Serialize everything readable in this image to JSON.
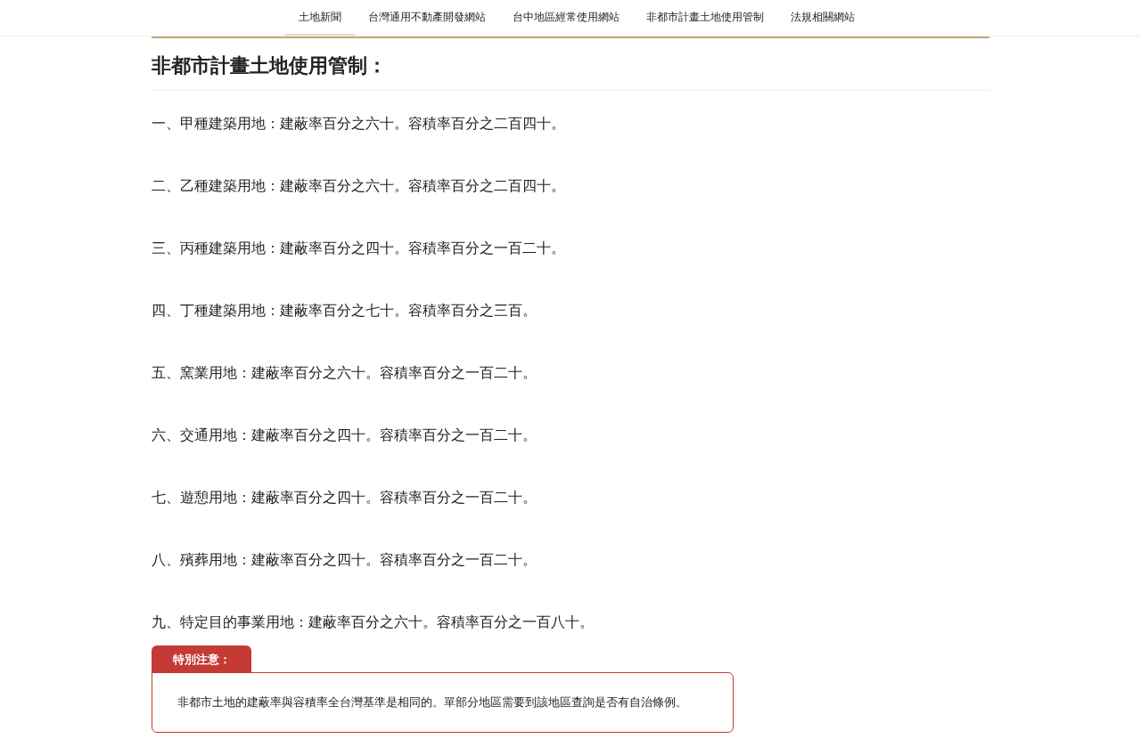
{
  "nav": {
    "tabs": [
      {
        "label": "土地新聞",
        "selected": true
      },
      {
        "label": "台灣通用不動產開發網站",
        "selected": false
      },
      {
        "label": "台中地區經常使用網站",
        "selected": false
      },
      {
        "label": "非都市計畫土地使用管制",
        "selected": false
      },
      {
        "label": "法規相關網站",
        "selected": false
      }
    ]
  },
  "heading": "非都市計畫土地使用管制：",
  "items": [
    "一、甲種建築用地：建蔽率百分之六十。容積率百分之二百四十。",
    "二、乙種建築用地：建蔽率百分之六十。容積率百分之二百四十。",
    "三、丙種建築用地：建蔽率百分之四十。容積率百分之一百二十。",
    "四、丁種建築用地：建蔽率百分之七十。容積率百分之三百。",
    "五、窯業用地：建蔽率百分之六十。容積率百分之一百二十。",
    "六、交通用地：建蔽率百分之四十。容積率百分之一百二十。",
    "七、遊憩用地：建蔽率百分之四十。容積率百分之一百二十。",
    "八、殯葬用地：建蔽率百分之四十。容積率百分之一百二十。",
    "九、特定目的事業用地：建蔽率百分之六十。容積率百分之一百八十。"
  ],
  "notice": {
    "label": "特別注意：",
    "text": "非都市土地的建蔽率與容積率全台灣基準是相同的。單部分地區需要到該地區查詢是否有自治條例。"
  }
}
